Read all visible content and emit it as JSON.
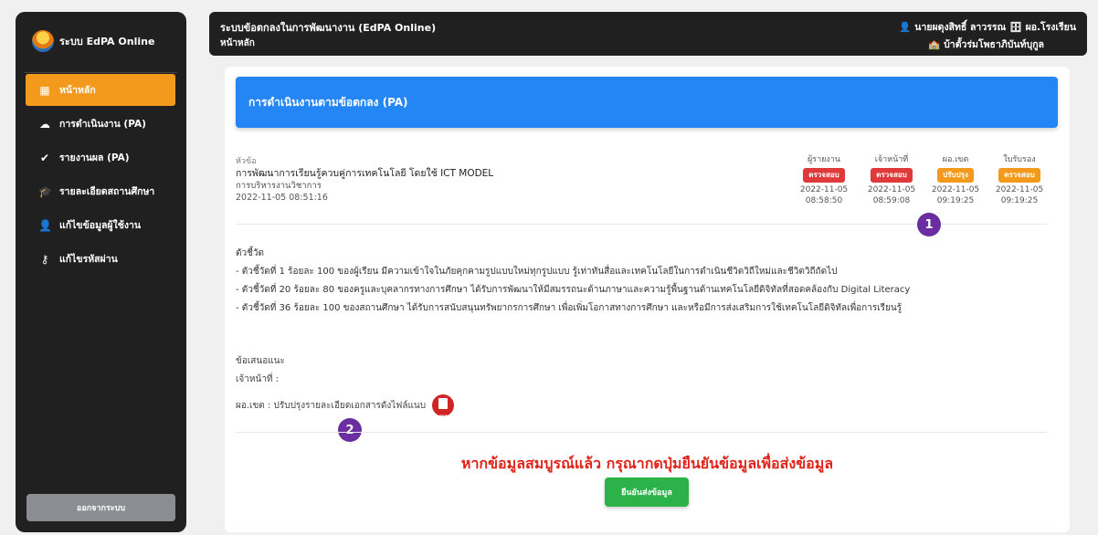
{
  "sidebar": {
    "brand": "ระบบ EdPA Online",
    "items": [
      {
        "label": "หน้าหลัก",
        "icon": "grid-icon",
        "active": true
      },
      {
        "label": "การดำเนินงาน (PA)",
        "icon": "cloud-upload-icon",
        "active": false
      },
      {
        "label": "รายงานผล (PA)",
        "icon": "check-circle-icon",
        "active": false
      },
      {
        "label": "รายละเอียดสถานศึกษา",
        "icon": "graduation-cap-icon",
        "active": false
      },
      {
        "label": "แก้ไขข้อมูลผู้ใช้งาน",
        "icon": "user-icon",
        "active": false
      },
      {
        "label": "แก้ไขรหัสผ่าน",
        "icon": "key-icon",
        "active": false
      }
    ],
    "logout": "ออกจากระบบ"
  },
  "topbar": {
    "title": "ระบบข้อตกลงในการพัฒนางาน (EdPA Online)",
    "breadcrumb": "หน้าหลัก",
    "user": "นายผดุงสิทธิ์ ลาวรรณ",
    "role": "ผอ.โรงเรียน",
    "school": "บ้าตั้วร่มโพธาภิบันท์บุกูล"
  },
  "card": {
    "header": "การดำเนินงานตามข้อตกลง (PA)",
    "topic_label": "หัวข้อ",
    "topic_title": "การพัฒนาการเรียนรู้ควบคู่การเทคโนโลยี โดยใช้ ICT MODEL",
    "topic_category": "การบริหารงานวิชาการ",
    "topic_date": "2022-11-05 08:51:16",
    "statuses": [
      {
        "label": "ผู้รายงาน",
        "badge": "ตรวจสอบ",
        "color": "#e0393a",
        "date": "2022-11-05",
        "time": "08:58:50"
      },
      {
        "label": "เจ้าหน้าที่",
        "badge": "ตรวจสอบ",
        "color": "#e0393a",
        "date": "2022-11-05",
        "time": "08:59:08"
      },
      {
        "label": "ผอ.เขต",
        "badge": "ปรับปรุง",
        "color": "#f39a1d",
        "date": "2022-11-05",
        "time": "09:19:25"
      },
      {
        "label": "ใบรับรอง",
        "badge": "ตรวจสอบ",
        "color": "#f39a1d",
        "date": "2022-11-05",
        "time": "09:19:25"
      }
    ],
    "indicators_title": "ตัวชี้วัด",
    "indicators": [
      "- ตัวชี้วัดที่ 1 ร้อยละ 100 ของผู้เรียน มีความเข้าใจในภัยคุกคามรูปแบบใหม่ทุกรูปแบบ รู้เท่าทันสื่อและเทคโนโลยีในการดำเนินชีวิตวิถีใหม่และชีวิตวิถีถัดไป",
      "- ตัวชี้วัดที่ 20 ร้อยละ 80 ของครูและบุคลากรทางการศึกษา ได้รับการพัฒนาให้มีสมรรถนะด้านภาษาและความรู้พื้นฐานด้านเทคโนโลยีดิจิทัลที่สอดคล้องกับ Digital Literacy",
      "- ตัวชี้วัดที่ 36 ร้อยละ 100 ของสถานศึกษา ได้รับการสนับสนุนทรัพยากรการศึกษา เพื่อเพิ่มโอกาสทางการศึกษา และหรือมีการส่งเสริมการใช้เทคโนโลยีดิจิทัลเพื่อการเรียนรู้"
    ],
    "advice_title": "ข้อเสนอแนะ",
    "advice_staff": "เจ้าหน้าที่ :",
    "advice_director": "ผอ.เขต : ปรับปรุงรายละเอียดเอกสารดังไฟล์แนบ",
    "marker_1": "1",
    "marker_2": "2",
    "notice": "หากข้อมูลสมบูรณ์แล้ว กรุณากดปุ่มยืนยันข้อมูลเพื่อส่งข้อมูล",
    "confirm_button": "ยืนยันส่งข้อมูล"
  }
}
